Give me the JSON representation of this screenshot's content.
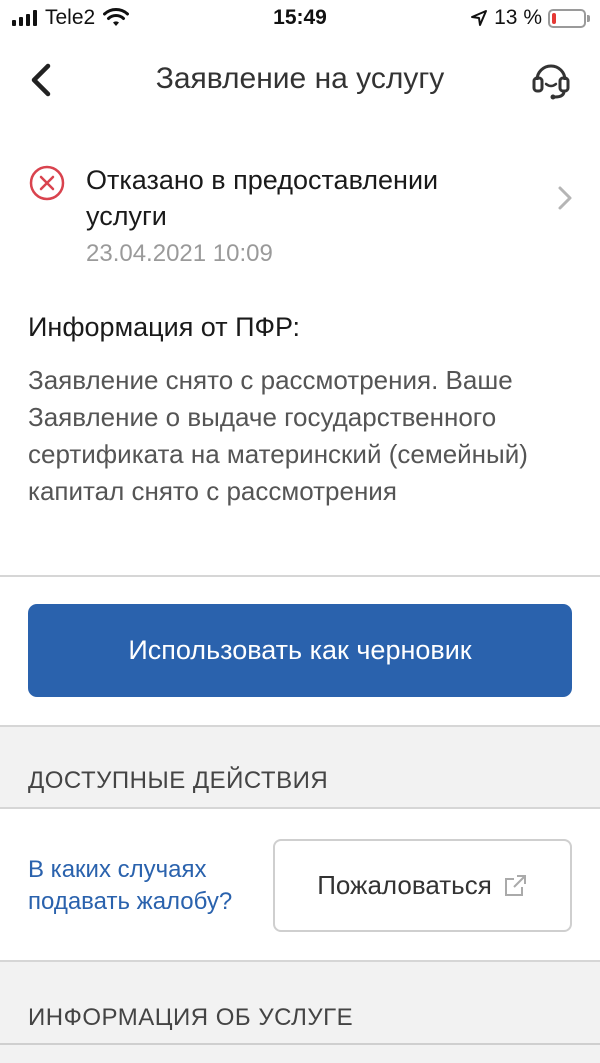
{
  "status_bar": {
    "carrier": "Tele2",
    "time": "15:49",
    "battery_text": "13 %",
    "battery_level": 0.13,
    "battery_color": "#e53935"
  },
  "nav": {
    "title": "Заявление на услугу",
    "back_icon": "chevron-left-icon",
    "support_icon": "headset-icon"
  },
  "application_status": {
    "icon": "error-circle-icon",
    "status_color": "#d9434e",
    "title": "Отказано в предоставлении услуги",
    "date": "23.04.2021 10:09"
  },
  "info": {
    "title": "Информация от ПФР:",
    "text": "Заявление снято с рассмотрения. Ваше Заявление о выдаче государственного сертификата на материнский (семейный) капитал снято с рассмотрения"
  },
  "draft_button": {
    "label": "Использовать как черновик",
    "color": "#2a62ad"
  },
  "actions": {
    "header": "ДОСТУПНЫЕ ДЕЙСТВИЯ",
    "complaint_link": "В каких случаях подавать жалобу?",
    "complain_button": "Пожаловаться",
    "external_icon": "external-link-icon"
  },
  "service_info": {
    "header": "ИНФОРМАЦИЯ ОБ УСЛУГЕ"
  }
}
